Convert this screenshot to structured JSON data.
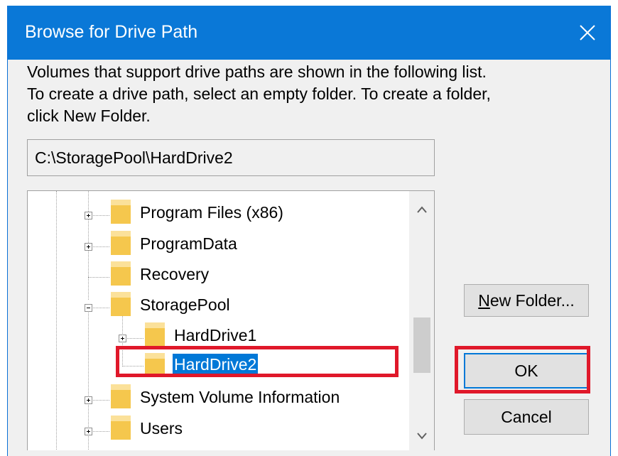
{
  "dialog": {
    "title": "Browse for Drive Path",
    "close_icon": "close-icon"
  },
  "instructions": {
    "line1": "Volumes that support drive paths are shown in the following list.",
    "line2": "To create a drive path, select an empty folder. To create a folder,",
    "line3": "click New Folder."
  },
  "path_field": {
    "value": "C:\\StoragePool\\HardDrive2"
  },
  "tree": {
    "items": [
      {
        "label": "Program Files (x86)",
        "expander": "plus"
      },
      {
        "label": "ProgramData",
        "expander": "plus"
      },
      {
        "label": "Recovery",
        "expander": "none"
      },
      {
        "label": "StoragePool",
        "expander": "minus"
      },
      {
        "label": "HardDrive1",
        "expander": "plus"
      },
      {
        "label": "HardDrive2",
        "expander": "none",
        "selected": true
      },
      {
        "label": "System Volume Information",
        "expander": "plus"
      },
      {
        "label": "Users",
        "expander": "plus"
      }
    ],
    "scroll_up_icon": "chevron-up-icon",
    "scroll_down_icon": "chevron-down-icon"
  },
  "buttons": {
    "new_folder_prefix": "N",
    "new_folder_rest": "ew Folder...",
    "ok": "OK",
    "cancel": "Cancel"
  },
  "colors": {
    "titlebar": "#0a78d7",
    "selection": "#0078d7",
    "highlight": "#e0182a",
    "folder": "#f5c74d"
  }
}
